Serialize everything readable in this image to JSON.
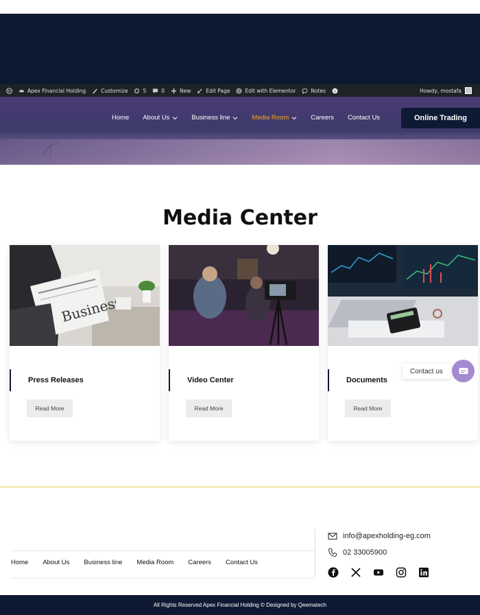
{
  "admin_bar": {
    "site_name": "Apex Financial Holding",
    "customize": "Customize",
    "updates_count": "5",
    "comments_count": "0",
    "new": "New",
    "edit_page": "Edit Page",
    "edit_elementor": "Edit with Elementor",
    "notes": "Notes",
    "howdy": "Howdy, mostafa"
  },
  "nav": {
    "items": [
      {
        "label": "Home",
        "has_dropdown": false,
        "active": false
      },
      {
        "label": "About Us",
        "has_dropdown": true,
        "active": false
      },
      {
        "label": "Business line",
        "has_dropdown": true,
        "active": false
      },
      {
        "label": "Media Room",
        "has_dropdown": true,
        "active": true
      },
      {
        "label": "Careers",
        "has_dropdown": false,
        "active": false
      },
      {
        "label": "Contact Us",
        "has_dropdown": false,
        "active": false
      }
    ],
    "cta": "Online Trading",
    "active_color": "#f5a623"
  },
  "main": {
    "title": "Media Center",
    "cards": [
      {
        "title": "Press Releases",
        "button": "Read More",
        "image_icon": "newspaper-photo"
      },
      {
        "title": "Video Center",
        "button": "Read More",
        "image_icon": "video-camera-photo"
      },
      {
        "title": "Documents",
        "button": "Read More",
        "image_icon": "trading-charts-photo"
      }
    ]
  },
  "contact_widget": {
    "label": "Contact us"
  },
  "footer": {
    "nav": [
      "Home",
      "About Us",
      "Business line",
      "Media Room",
      "Careers",
      "Contact Us"
    ],
    "email": "info@apexholding-eg.com",
    "phone": "02 33005900",
    "socials": [
      "facebook-icon",
      "x-icon",
      "youtube-icon",
      "instagram-icon",
      "linkedin-icon"
    ],
    "copyright": "All Rights Reserved Apex Financial Holding © Designed by  Qeematech"
  },
  "colors": {
    "navy": "#0e1a33",
    "accent": "#f5a623",
    "gold_line": "#e6c84a",
    "fab": "#a48ad0"
  }
}
